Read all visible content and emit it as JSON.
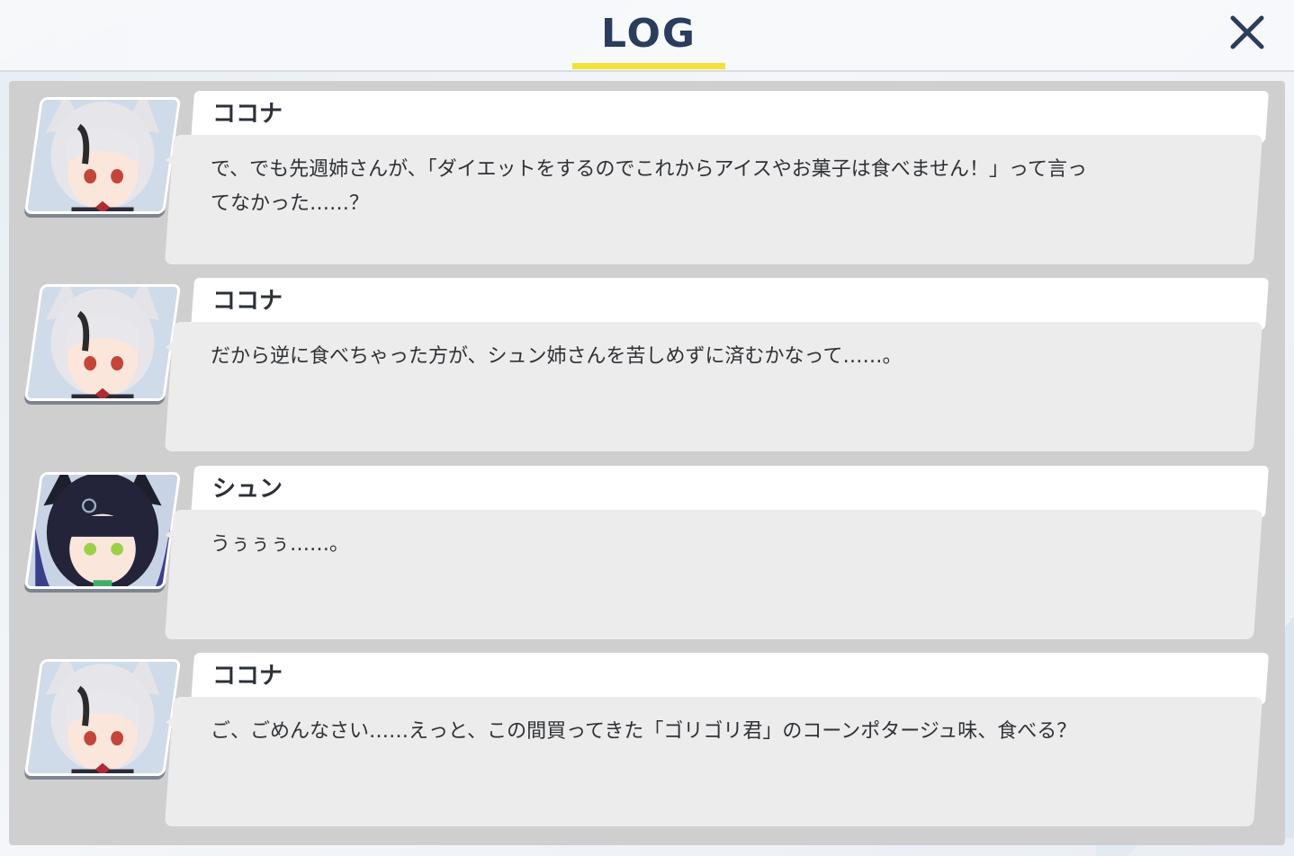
{
  "header": {
    "title": "LOG",
    "accent_color": "#f3e23a",
    "title_color": "#2a3d5c"
  },
  "close_icon": "close-icon",
  "entries": [
    {
      "speaker": "ココナ",
      "avatar": "kokona-avatar",
      "text": "で、でも先週姉さんが、「ダイエットをするのでこれからアイスやお菓子は食べません！」って言ってなかった……？"
    },
    {
      "speaker": "ココナ",
      "avatar": "kokona-avatar",
      "text": "だから逆に食べちゃった方が、シュン姉さんを苦しめずに済むかなって……。"
    },
    {
      "speaker": "シュン",
      "avatar": "shun-avatar",
      "text": "うぅぅぅ……。"
    },
    {
      "speaker": "ココナ",
      "avatar": "kokona-avatar",
      "text": "ご、ごめんなさい……えっと、この間買ってきた「ゴリゴリ君」のコーンポタージュ味、食べる？"
    }
  ]
}
